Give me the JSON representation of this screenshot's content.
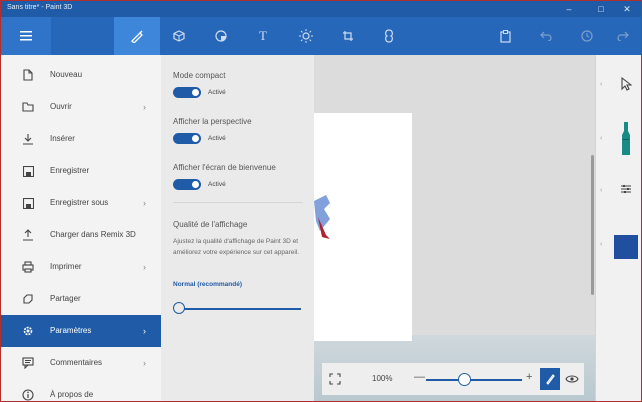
{
  "window": {
    "title": "Sans titre* - Paint 3D",
    "controls": [
      "minimize",
      "maximize",
      "close"
    ]
  },
  "toolbar": {
    "items": [
      {
        "name": "menu",
        "icon": "hamburger-icon"
      },
      {
        "name": "brushes",
        "icon": "brush-icon"
      },
      {
        "name": "3d-shapes",
        "icon": "cube-icon"
      },
      {
        "name": "stickers",
        "icon": "sticker-icon"
      },
      {
        "name": "text",
        "icon": "text-icon",
        "glyph": "T"
      },
      {
        "name": "effects",
        "icon": "sun-icon"
      },
      {
        "name": "canvas",
        "icon": "canvas-crop-icon"
      },
      {
        "name": "remix3d",
        "icon": "remix-icon"
      },
      {
        "name": "paste",
        "icon": "paste-icon"
      },
      {
        "name": "undo",
        "icon": "undo-icon"
      },
      {
        "name": "history",
        "icon": "history-icon"
      },
      {
        "name": "redo",
        "icon": "redo-icon"
      }
    ]
  },
  "menu": {
    "items": [
      {
        "label": "Nouveau",
        "icon": "new-file-icon",
        "chevron": false
      },
      {
        "label": "Ouvrir",
        "icon": "folder-icon",
        "chevron": true
      },
      {
        "label": "Insérer",
        "icon": "insert-icon",
        "chevron": false
      },
      {
        "label": "Enregistrer",
        "icon": "save-icon",
        "chevron": false
      },
      {
        "label": "Enregistrer sous",
        "icon": "save-as-icon",
        "chevron": true
      },
      {
        "label": "Charger dans Remix 3D",
        "icon": "upload-icon",
        "chevron": false
      },
      {
        "label": "Imprimer",
        "icon": "print-icon",
        "chevron": true
      },
      {
        "label": "Partager",
        "icon": "share-icon",
        "chevron": false
      },
      {
        "label": "Paramètres",
        "icon": "gear-icon",
        "chevron": true,
        "active": true
      },
      {
        "label": "Commentaires",
        "icon": "feedback-icon",
        "chevron": true
      },
      {
        "label": "À propos de",
        "icon": "info-icon",
        "chevron": false
      }
    ],
    "chevron_glyph": "›"
  },
  "settings": {
    "compact_label": "Mode compact",
    "compact_state": "Activé",
    "perspective_label": "Afficher la perspective",
    "perspective_state": "Activé",
    "welcome_label": "Afficher l'écran de bienvenue",
    "welcome_state": "Activé",
    "quality_title": "Qualité de l'affichage",
    "quality_desc": "Ajustez la qualité d'affichage de Paint 3D et améliorez votre expérience sur cet appareil.",
    "quality_value": "Normal (recommandé)",
    "quality_level": 0.0
  },
  "zoom": {
    "percent": "100%",
    "minus": "—",
    "plus": "+",
    "level": 0.4
  },
  "right_panel": {
    "items": [
      {
        "name": "select-tool",
        "icon": "cursor-icon"
      },
      {
        "name": "marker-tool",
        "icon": "marker-icon"
      },
      {
        "name": "properties",
        "icon": "sliders-icon"
      },
      {
        "name": "color",
        "icon": "color-swatch",
        "color": "#1f4f9e"
      }
    ]
  },
  "colors": {
    "accent": "#1f5ba6",
    "toolbar": "#2767ba",
    "marker": "#1a8a86"
  }
}
